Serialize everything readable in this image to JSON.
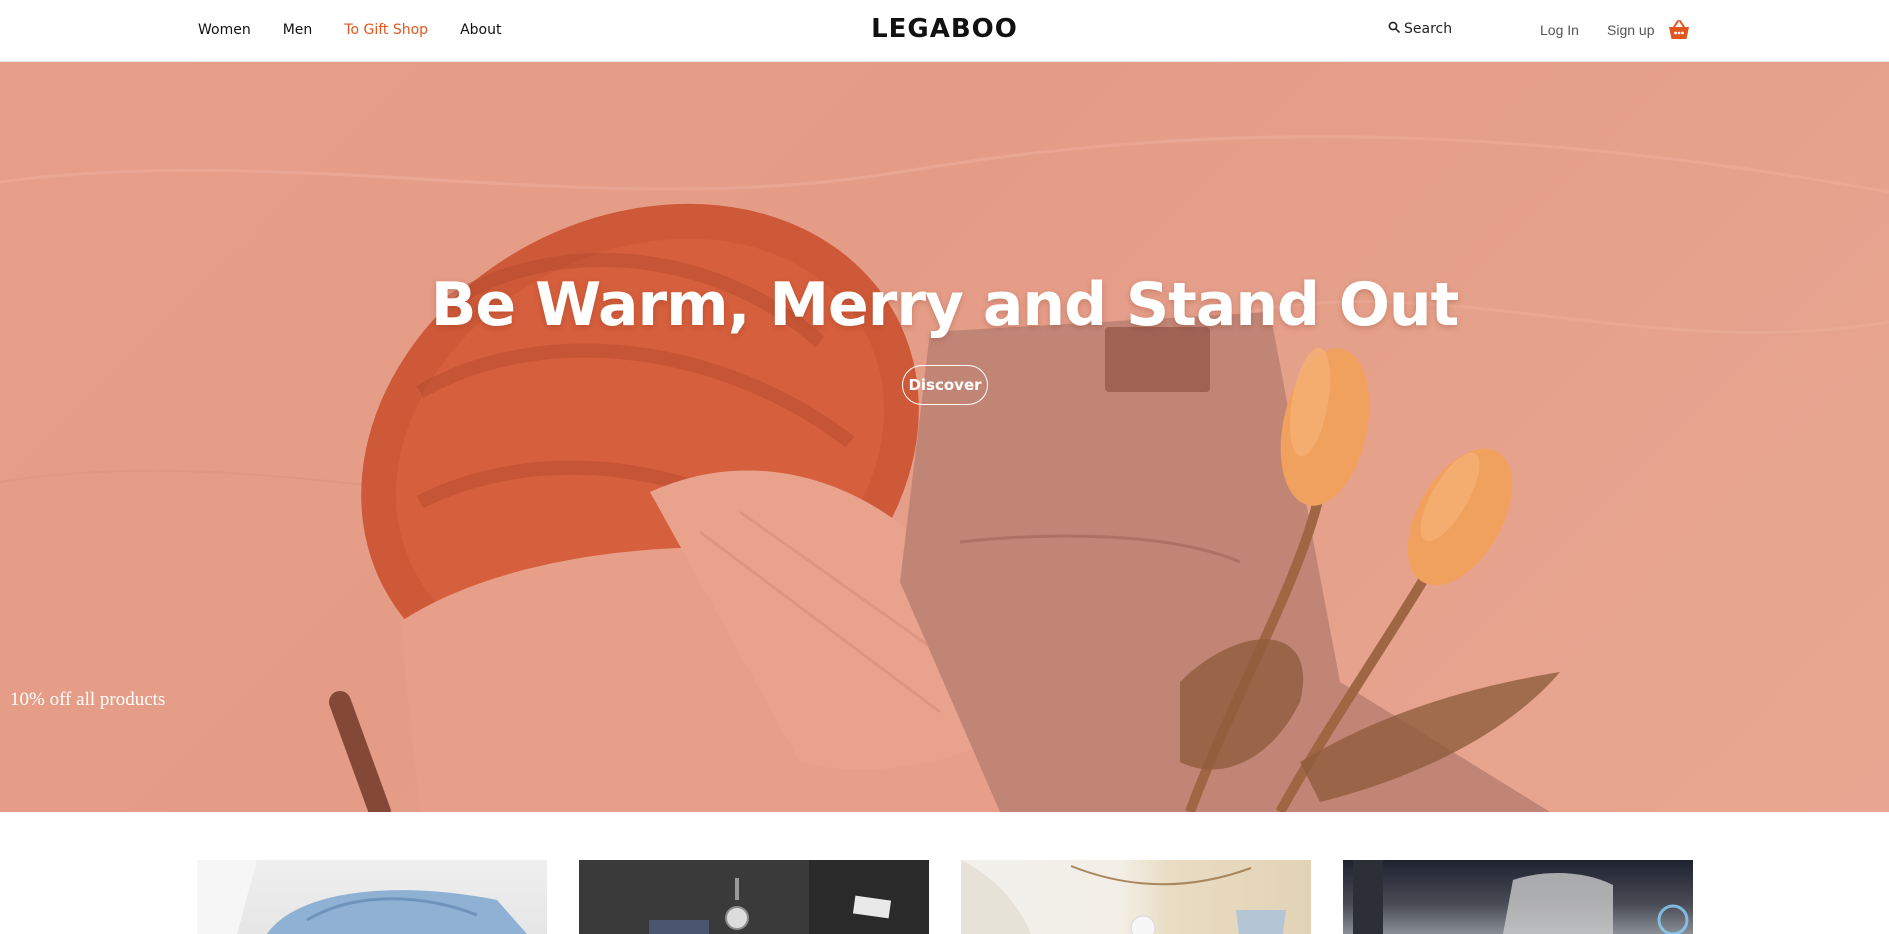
{
  "header": {
    "nav": [
      {
        "label": "Women"
      },
      {
        "label": "Men"
      },
      {
        "label": "To Gift Shop"
      },
      {
        "label": "About"
      }
    ],
    "logo": "LEGABOO",
    "search_label": "Search",
    "login_label": "Log In",
    "signup_label": "Sign up"
  },
  "hero": {
    "title": "Be Warm, Merry and Stand Out",
    "cta_label": "Discover",
    "promo_text": "10% off all products"
  },
  "colors": {
    "accent": "#e0561e",
    "hero_bg": "#e3a08c"
  },
  "icons": {
    "search": "search-icon",
    "cart": "basket-icon"
  }
}
